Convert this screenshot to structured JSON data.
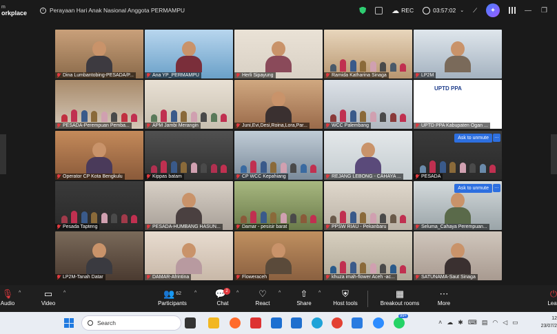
{
  "app": {
    "brand_line1": "m",
    "brand_line2": "orkplace",
    "meeting_title": "Perayaan Hari Anak Nasional Anggota PERMAMPU",
    "rec_label": "REC",
    "timer": "03:57:02"
  },
  "participants": [
    {
      "name": "Dina Lumbantobing-PESADA/P...",
      "muted": true,
      "active": true
    },
    {
      "name": "Ana YP_PERMAMPU",
      "muted": true
    },
    {
      "name": "Herli Sipayung",
      "muted": true
    },
    {
      "name": "Ramida Katharina Sinaga",
      "muted": true
    },
    {
      "name": "LP2M",
      "muted": true
    },
    {
      "name": "PESADA-Perempuan Pemba...",
      "muted": true
    },
    {
      "name": "APM Jambi Merangin",
      "muted": true
    },
    {
      "name": "Juni,Evi,Desi,Roina,Lora,Par...",
      "muted": true
    },
    {
      "name": "WCC Palembang",
      "muted": true
    },
    {
      "name": "UPTD PPA Kabupaten Ogan ...",
      "muted": true,
      "logo_text": "UPTD PPA"
    },
    {
      "name": "Operator CP Kota Bengkulu",
      "muted": true
    },
    {
      "name": "Kippas batam",
      "muted": true
    },
    {
      "name": "CP WCC Kepahiang",
      "muted": true
    },
    {
      "name": "REJANG LEBONG - CAHAYA ...",
      "muted": true
    },
    {
      "name": "PESADA",
      "muted": true,
      "unmute": "Ask to unmute"
    },
    {
      "name": "Pesada Tapteng",
      "muted": true
    },
    {
      "name": "PESADA-HUMBANG HASUN...",
      "muted": true
    },
    {
      "name": "Damar - pesisir barat",
      "muted": true
    },
    {
      "name": "PPSW RIAU - Pekanbaru",
      "muted": true
    },
    {
      "name": "Seluma_Cahaya Perempuan...",
      "muted": true,
      "unmute": "Ask to unmute"
    },
    {
      "name": "LP2M-Tanah Datar",
      "muted": true
    },
    {
      "name": "DAMAR-Afrintina",
      "muted": true
    },
    {
      "name": "Floweraceh",
      "muted": true
    },
    {
      "name": "khuza imah-flower Aceh -ac...",
      "muted": true
    },
    {
      "name": "SATUNAMA-Saut Sinaga",
      "muted": true
    }
  ],
  "controls": {
    "audio": "Audio",
    "video": "Video",
    "participants": "Participants",
    "participants_count": "62",
    "chat": "Chat",
    "chat_badge": "2",
    "react": "React",
    "share": "Share",
    "host_tools": "Host tools",
    "breakout": "Breakout rooms",
    "more": "More",
    "leave": "Leav"
  },
  "taskbar": {
    "search_placeholder": "Search",
    "badge": "99+",
    "time_line1": "12",
    "time_line2": "23/07/2"
  },
  "colors": {
    "active_speaker": "#2ecc71",
    "muted": "#e0393e",
    "unmute_button": "#2d6fe0"
  }
}
